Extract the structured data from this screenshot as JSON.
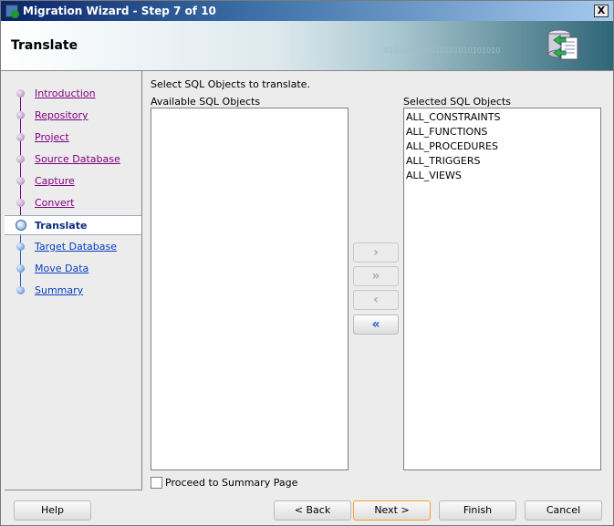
{
  "window": {
    "title": "Migration Wizard - Step 7 of 10",
    "close_label": "X"
  },
  "header": {
    "title": "Translate",
    "binary_text": "0101010101010101010101010"
  },
  "steps": [
    {
      "label": "Introduction",
      "state": "done"
    },
    {
      "label": "Repository",
      "state": "done"
    },
    {
      "label": "Project",
      "state": "done"
    },
    {
      "label": "Source Database",
      "state": "done"
    },
    {
      "label": "Capture ",
      "state": "done"
    },
    {
      "label": "Convert",
      "state": "done"
    },
    {
      "label": "Translate",
      "state": "current"
    },
    {
      "label": "Target Database",
      "state": "todo"
    },
    {
      "label": "Move Data",
      "state": "todo"
    },
    {
      "label": "Summary",
      "state": "todo"
    }
  ],
  "main": {
    "instruction": "Select SQL Objects to translate.",
    "available_label": "Available SQL Objects",
    "available_items": [],
    "selected_label": "Selected SQL Objects",
    "selected_items": [
      "ALL_CONSTRAINTS",
      "ALL_FUNCTIONS",
      "ALL_PROCEDURES",
      "ALL_TRIGGERS",
      "ALL_VIEWS"
    ],
    "shuttle": {
      "add": "›",
      "add_all": "»",
      "remove": "‹",
      "remove_all": "«"
    },
    "proceed_label": "Proceed to Summary Page",
    "proceed_checked": false
  },
  "buttons": {
    "help": "Help",
    "back": "< Back",
    "next": "Next >",
    "finish": "Finish",
    "cancel": "Cancel"
  },
  "colors": {
    "visited_link": "#800080",
    "link": "#0a3ec0",
    "default_button_border": "#f0a030"
  }
}
